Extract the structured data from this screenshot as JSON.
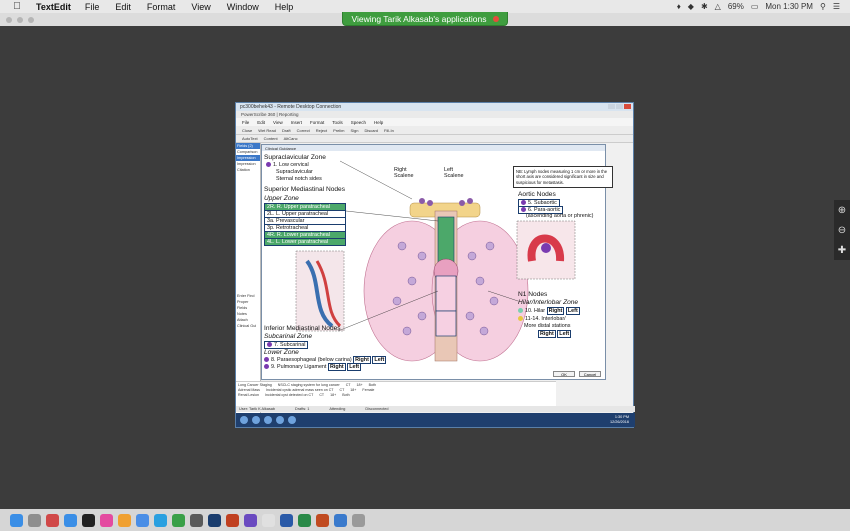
{
  "menubar": {
    "app_name": "TextEdit",
    "items": [
      "File",
      "Edit",
      "Format",
      "View",
      "Window",
      "Help"
    ],
    "battery": "69%",
    "clock": "Mon 1:30 PM"
  },
  "banner": {
    "text": "Viewing Tarik Alkasab's applications"
  },
  "rdp": {
    "title": "pc300behek43 - Remote Desktop Connection",
    "app_title": "PowerScribe 360 | Reporting",
    "menu": [
      "File",
      "Edit",
      "View",
      "Insert",
      "Format",
      "Tools",
      "Speech",
      "Help"
    ],
    "toolbar": [
      "Close",
      "Wet Read",
      "Draft",
      "Correct",
      "Reject",
      "Prelim",
      "Sign",
      "Discard",
      "Fill-In",
      "AutoText",
      "Content",
      "AltCanc"
    ],
    "left_items": [
      "Fields (2)",
      "Comparison",
      "Impression",
      "Impression",
      "Citation"
    ],
    "left_lower": [
      "Enter Find",
      "Proper",
      "Fields",
      "Notes",
      "Attach"
    ],
    "clinical_label": "Clinical Gui",
    "modal_title": "Clinical Guidance",
    "note": "NB: Lymph nodes measuring 1 cm or more in the short axis are considered significant in size and suspicious for metastasis.",
    "sides": {
      "right": "Right",
      "left": "Left",
      "scalene_r": "Scalene",
      "scalene_l": "Scalene"
    },
    "supraclavicular": {
      "title": "Supraclavicular Zone",
      "lines": [
        "1. Low cervical",
        "Supraclavicular",
        "Sternal notch sides"
      ]
    },
    "superior": {
      "title": "Superior Mediastinal Nodes",
      "zone": "Upper Zone",
      "stations": [
        "2R. R. Upper paratracheal",
        "2L. L. Upper paratracheal",
        "3a. Prevascular",
        "3p. Retrotracheal",
        "4R. R. Lower paratracheal",
        "4L. L. Lower paratracheal"
      ]
    },
    "aortic": {
      "title": "Aortic Nodes",
      "stations": [
        "5. Subaortic",
        "6. Para-aortic",
        "(ascending aorta or phrenic)"
      ]
    },
    "inferior": {
      "title": "Inferior Mediastinal Nodes",
      "zone1": "Subcarinal Zone",
      "station7": "7. Subcarinal",
      "zone2": "Lower Zone",
      "station8": "8. Paraesophageal (below carina)",
      "station9": "9. Pulmonary Ligament"
    },
    "n1": {
      "title": "N1 Nodes",
      "zone": "Hilar/Interlobar Zone",
      "hilar": "10. Hilar",
      "interlobar": "11-14. Interlobar/",
      "more_distal": "More distal stations"
    },
    "tags": {
      "right": "Right",
      "left": "Left"
    },
    "buttons": {
      "ok": "OK",
      "cancel": "Cancel"
    },
    "grid_rows": [
      [
        "Long Cancer Staging",
        "NSCLC staging system for lung cancer",
        "CT",
        "18+",
        "Both"
      ],
      [
        "Adrenal Mass",
        "Incidental cystic adrenal mass seen on CT",
        "CT",
        "18+",
        "Female"
      ],
      [
        "Renal Lesion",
        "Incidental cyst detected on CT",
        "CT",
        "18+",
        "Both"
      ]
    ],
    "status": {
      "user": "User: Tarik K Alkasab",
      "drafts": "Drafts: 1",
      "attending": "Attending",
      "disconnected": "Disconnected"
    },
    "clock": {
      "time": "1:30 PM",
      "date": "12/26/2016"
    }
  }
}
